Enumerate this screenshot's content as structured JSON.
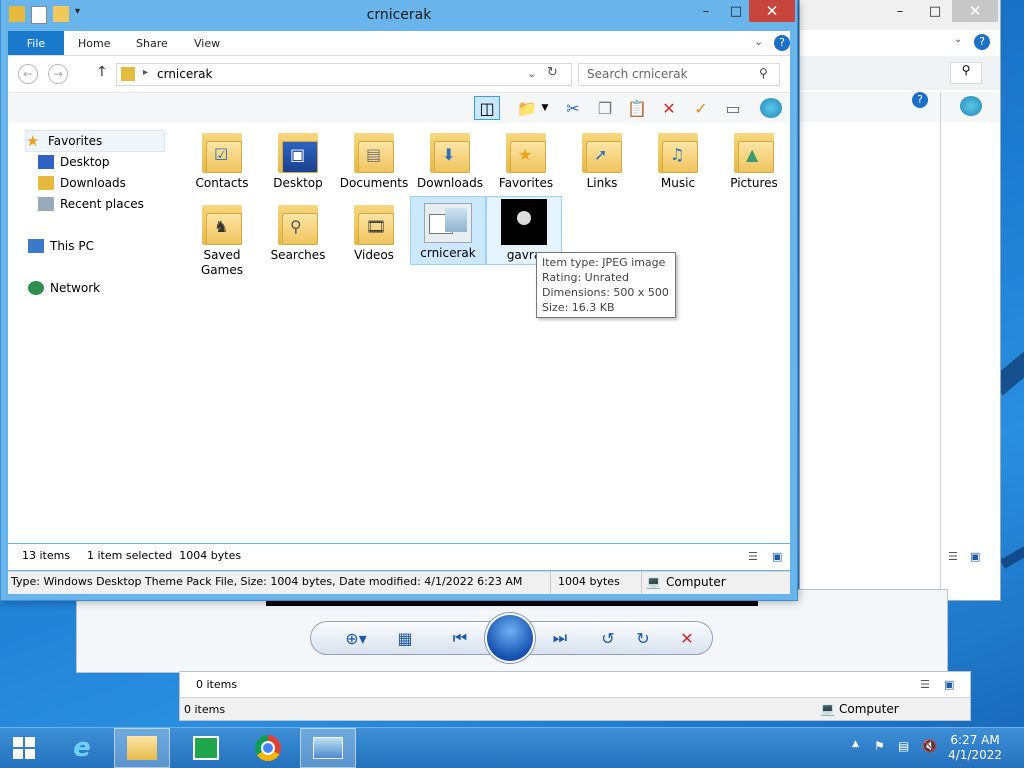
{
  "explorer": {
    "title": "crnicerak",
    "ribbon_tabs": {
      "file": "File",
      "home": "Home",
      "share": "Share",
      "view": "View"
    },
    "address_path": "crnicerak",
    "search_placeholder": "Search crnicerak",
    "nav": {
      "favorites": "Favorites",
      "desktop": "Desktop",
      "downloads": "Downloads",
      "recent": "Recent places",
      "this_pc": "This PC",
      "network": "Network"
    },
    "items": [
      {
        "label": "Contacts",
        "glyph": "contacts-icon"
      },
      {
        "label": "Desktop",
        "glyph": "desktop-icon"
      },
      {
        "label": "Documents",
        "glyph": "documents-icon"
      },
      {
        "label": "Downloads",
        "glyph": "downloads-icon"
      },
      {
        "label": "Favorites",
        "glyph": "favorites-icon"
      },
      {
        "label": "Links",
        "glyph": "links-icon"
      },
      {
        "label": "Music",
        "glyph": "music-icon"
      },
      {
        "label": "Pictures",
        "glyph": "pictures-icon"
      },
      {
        "label": "Saved Games",
        "glyph": "saved-games-icon"
      },
      {
        "label": "Searches",
        "glyph": "searches-icon"
      },
      {
        "label": "Videos",
        "glyph": "videos-icon"
      },
      {
        "label": "crnicerak",
        "glyph": "theme-pack-icon"
      },
      {
        "label": "gavra",
        "glyph": "jpeg-icon"
      }
    ],
    "tooltip": {
      "type": "Item type: JPEG image",
      "rating": "Rating: Unrated",
      "dimensions": "Dimensions: 500 x 500",
      "size": "Size: 16.3 KB"
    },
    "status": {
      "count": "13 items",
      "selected": "1 item selected  1004 bytes"
    },
    "details": {
      "info": "Type: Windows Desktop Theme Pack File, Size: 1004 bytes, Date modified: 4/1/2022 6:23 AM",
      "size": "1004 bytes",
      "location": "Computer"
    }
  },
  "bottom_window": {
    "items1": "0 items",
    "items2": "0 items",
    "location": "Computer"
  },
  "taskbar": {
    "time": "6:27 AM",
    "date": "4/1/2022"
  },
  "colors": {
    "accent": "#1979ca",
    "taskbar": "#2b78c2",
    "selection": "#cce8ff"
  }
}
